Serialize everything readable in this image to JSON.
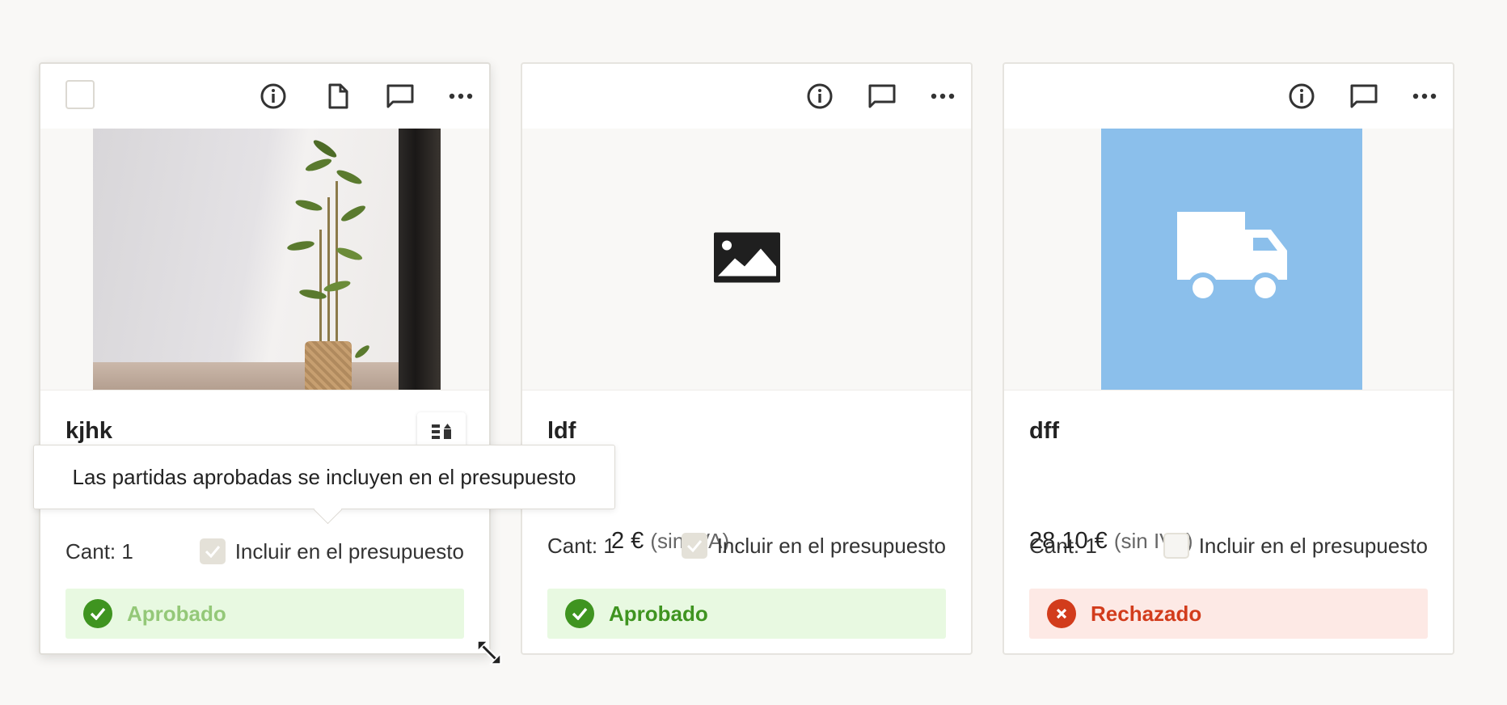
{
  "colors": {
    "approved_text": "#3f9420",
    "approved_bg": "#e8f9e1",
    "rejected_text": "#d23c1c",
    "rejected_bg": "#fde9e5",
    "placeholder_blue": "#8bbfeb"
  },
  "tooltip": {
    "text": "Las partidas aprobadas se incluyen en el presupuesto"
  },
  "cards": [
    {
      "name": "kjhk",
      "qty": "Cant: 1",
      "include_label": "Incluir en el presupuesto",
      "include_checked": true,
      "status": "Aprobado",
      "image": "photo-plant",
      "icons": [
        "info-icon",
        "document-icon",
        "comment-icon",
        "more-icon"
      ]
    },
    {
      "name": "ldf",
      "price": "2 €",
      "tax": "(sin IVA)",
      "qty": "Cant: 1",
      "include_label": "Incluir en el presupuesto",
      "include_checked": true,
      "status": "Aprobado",
      "image": "image-placeholder-icon",
      "icons": [
        "info-icon",
        "comment-icon",
        "more-icon"
      ]
    },
    {
      "name": "dff",
      "price": "28,10 €",
      "tax": "(sin IVA)",
      "qty": "Cant: 1",
      "include_label": "Incluir en el presupuesto",
      "include_checked": false,
      "status": "Rechazado",
      "image": "truck-icon",
      "icons": [
        "info-icon",
        "comment-icon",
        "more-icon"
      ]
    }
  ]
}
